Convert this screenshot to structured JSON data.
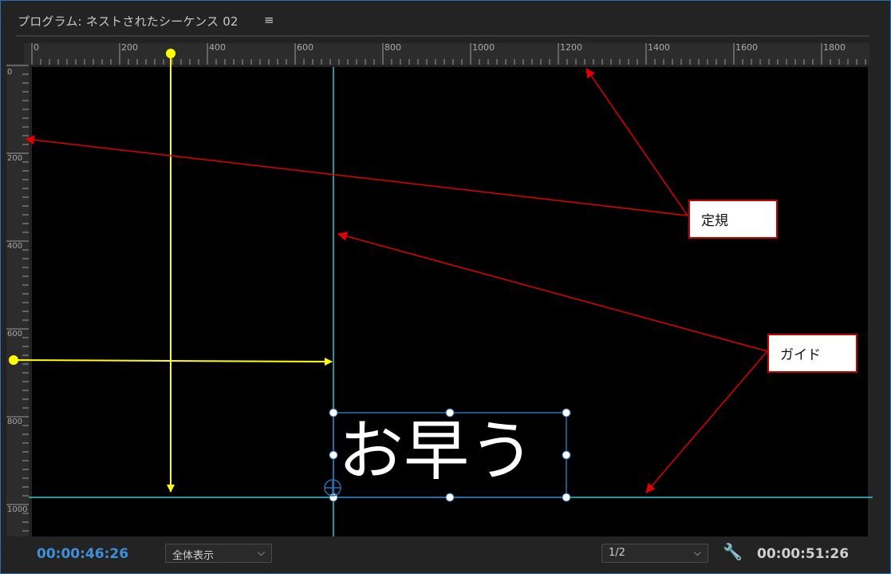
{
  "panel": {
    "title": "プログラム: ネストされたシーケンス 02",
    "menu_icon": "hamburger-menu-icon"
  },
  "rulers": {
    "horizontal_labels": [
      "0",
      "200",
      "400",
      "600",
      "800",
      "1000",
      "1200",
      "1400",
      "1600",
      "1800"
    ],
    "vertical_labels": [
      "0",
      "200",
      "400",
      "600",
      "800",
      "1000"
    ]
  },
  "viewer": {
    "text_content": "お早う"
  },
  "footer": {
    "timecode_current": "00:00:46:26",
    "zoom_select": "全体表示",
    "resolution_select": "1/2",
    "settings_icon": "wrench-icon",
    "timecode_duration": "00:00:51:26"
  },
  "annotations": {
    "ruler_callout": "定規",
    "guide_callout": "ガイド"
  },
  "colors": {
    "guide": "#2ec9d8",
    "selection": "#2b6fb3",
    "arrow_yellow": "#ffff00",
    "arrow_red": "#e00000",
    "timecode_blue": "#3f8fdc"
  }
}
